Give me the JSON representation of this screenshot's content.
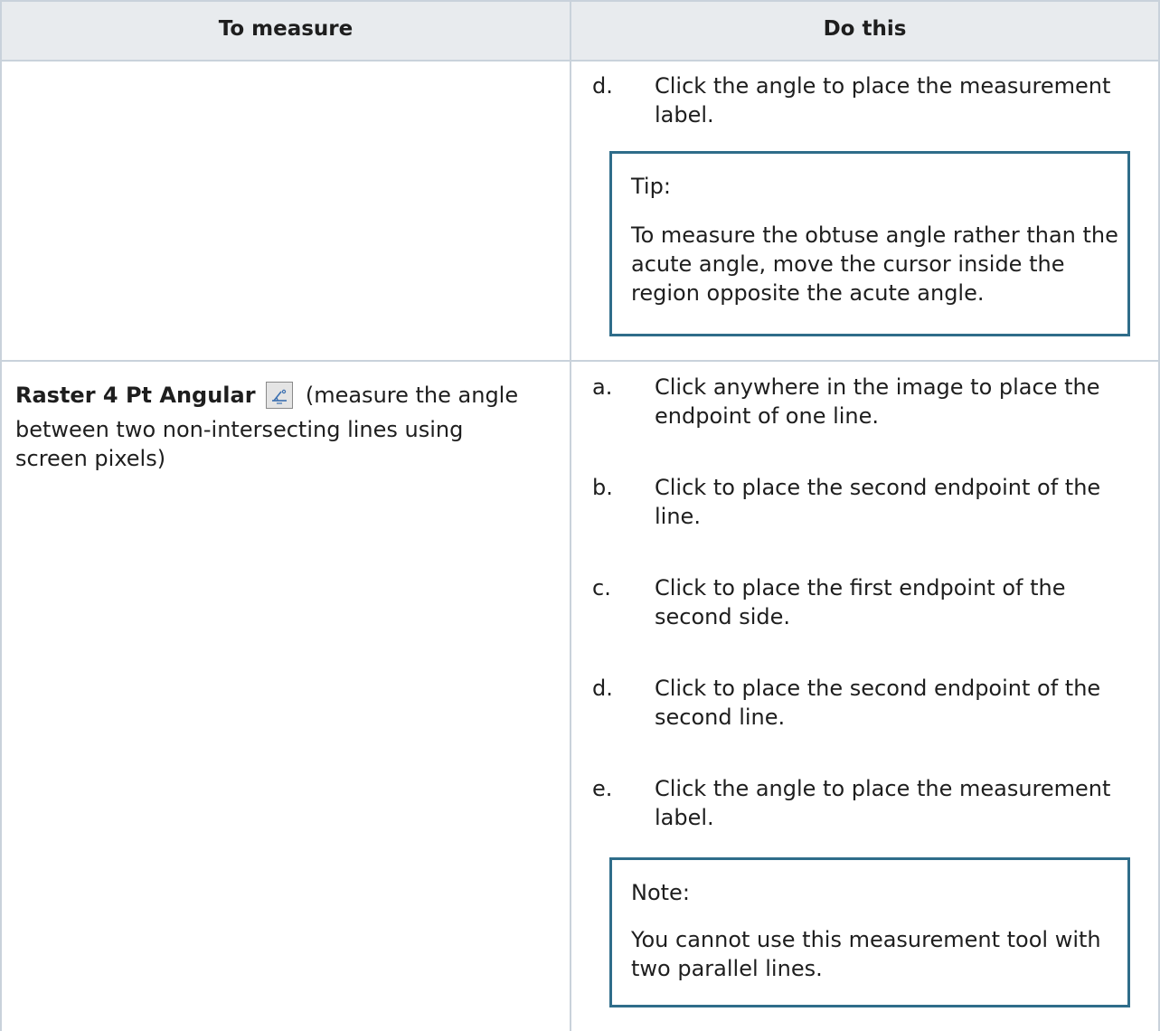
{
  "table": {
    "headers": {
      "col1": "To measure",
      "col2": "Do this"
    },
    "row1": {
      "steps": [
        {
          "letter": "d.",
          "text": "Click the angle to place the measurement label."
        }
      ],
      "callout": {
        "label": "Tip:",
        "body": "To measure the obtuse angle rather than the acute angle, move the cursor inside the region opposite the acute angle."
      }
    },
    "row2": {
      "tool_name": "Raster 4 Pt Angular",
      "tool_icon": "angle-measure-icon",
      "description_line1": "(measure the angle",
      "description_line2": "between two non-intersecting lines using",
      "description_line3": "screen pixels)",
      "steps": [
        {
          "letter": "a.",
          "text": "Click anywhere in the image to place the endpoint of one line."
        },
        {
          "letter": "b.",
          "text": "Click to place the second endpoint of the line."
        },
        {
          "letter": "c.",
          "text": "Click to place the first endpoint of the second side."
        },
        {
          "letter": "d.",
          "text": "Click to place the second endpoint of the second line."
        },
        {
          "letter": "e.",
          "text": "Click the angle to place the measurement label."
        }
      ],
      "callout": {
        "label": "Note:",
        "body": "You cannot use this measurement tool with two parallel lines."
      }
    }
  },
  "colors": {
    "header_background": "#e8ebee",
    "grid_line": "#c9d2db",
    "callout_border": "#2f6d8a",
    "text": "#1e1e1e"
  }
}
